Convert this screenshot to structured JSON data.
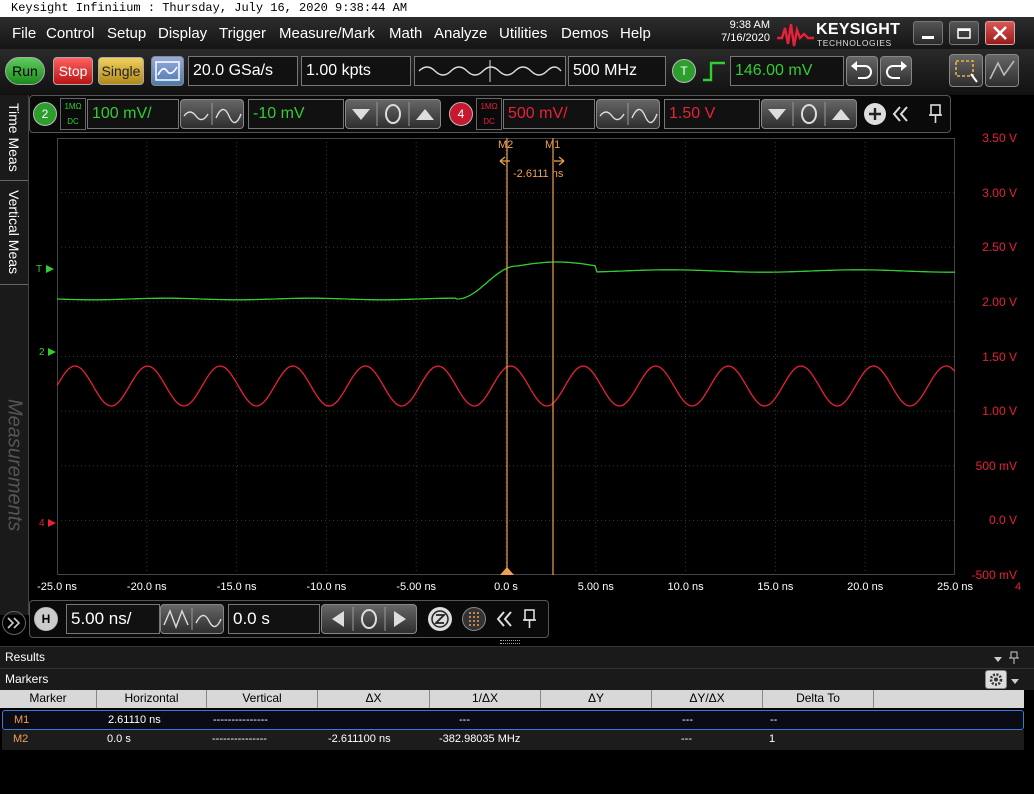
{
  "window": {
    "title": "Keysight Infiniium : Thursday, July 16, 2020 9:38:44 AM",
    "clock_time": "9:38 AM",
    "clock_date": "7/16/2020",
    "brand": "KEYSIGHT",
    "brand_sub": "TECHNOLOGIES"
  },
  "menu": [
    "File",
    "Control",
    "Setup",
    "Display",
    "Trigger",
    "Measure/Mark",
    "Math",
    "Analyze",
    "Utilities",
    "Demos",
    "Help"
  ],
  "toolbar": {
    "run_label": "Run",
    "stop_label": "Stop",
    "single_label": "Single",
    "sample_rate": "20.0 GSa/s",
    "memory_depth": "1.00 kpts",
    "bandwidth": "500 MHz",
    "trigger_badge": "T",
    "trigger_level": "146.00 mV"
  },
  "channels": [
    {
      "number": "2",
      "coupling_top": "1MΩ",
      "coupling_bottom": "DC",
      "scale": "100 mV/",
      "offset": "-10 mV",
      "color": "#33cc33"
    },
    {
      "number": "4",
      "coupling_top": "1MΩ",
      "coupling_bottom": "DC",
      "scale": "500 mV/",
      "offset": "1.50 V",
      "color": "#e8213a"
    }
  ],
  "side_tabs": [
    "Time Meas",
    "Vertical Meas",
    "Measurements"
  ],
  "graticule": {
    "x_ticks": [
      "-25.0 ns",
      "-20.0 ns",
      "-15.0 ns",
      "-10.0 ns",
      "-5.00 ns",
      "0.0 s",
      "5.00 ns",
      "10.0 ns",
      "15.0 ns",
      "20.0 ns",
      "25.0 ns"
    ],
    "y_ticks": [
      "3.50 V",
      "3.00 V",
      "2.50 V",
      "2.00 V",
      "1.50 V",
      "1.00 V",
      "500 mV",
      "0.0 V",
      "-500 mV"
    ],
    "right_edge_label": "4",
    "marker_m2_label": "M2",
    "marker_m1_label": "M1",
    "marker_delta": "-2.6111 ns",
    "ground_marker_ch2": "2",
    "ground_marker_ch4": "4",
    "trigger_marker": "T",
    "colors": {
      "ch2": "#33cc33",
      "ch4": "#e8213a",
      "marker": "#f0a050",
      "grid": "#3a3a3a",
      "y_axis_text": "#e8213a"
    }
  },
  "horizontal": {
    "badge": "H",
    "scale": "5.00 ns/",
    "position": "0.0 s"
  },
  "results": {
    "title": "Results",
    "markers_title": "Markers",
    "columns": [
      "Marker",
      "Horizontal",
      "Vertical",
      "ΔX",
      "1/ΔX",
      "ΔY",
      "ΔY/ΔX",
      "Delta To"
    ],
    "rows": [
      {
        "marker": "M1",
        "horizontal": "2.61110 ns",
        "vertical": "---------------",
        "dx": "",
        "inv_dx": "---",
        "dy": "",
        "dydx": "---",
        "delta_to": "--"
      },
      {
        "marker": "M2",
        "horizontal": "0.0 s",
        "vertical": "---------------",
        "dx": "-2.611100 ns",
        "inv_dx": "-382.98035 MHz",
        "dy": "",
        "dydx": "---",
        "delta_to": "1"
      }
    ]
  }
}
